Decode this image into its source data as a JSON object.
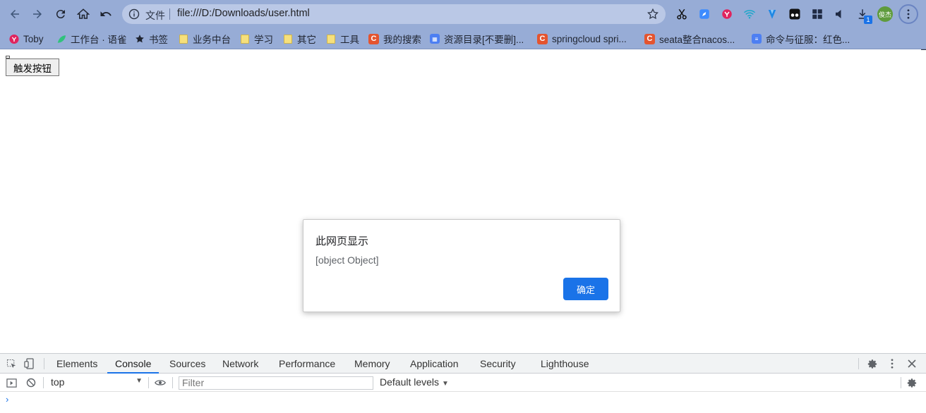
{
  "browser": {
    "url_scheme": "文件",
    "url": "file:///D:/Downloads/user.html",
    "profile_name": "俊杰",
    "download_badge": "1",
    "bookmarks": [
      {
        "label": "Toby",
        "icon": "red-circle-icon"
      },
      {
        "label": "工作台 · 语雀",
        "icon": "green-leaf-icon"
      },
      {
        "label": "书签",
        "icon": "star-icon"
      },
      {
        "label": "业务中台",
        "icon": "folder-icon"
      },
      {
        "label": "学习",
        "icon": "folder-icon"
      },
      {
        "label": "其它",
        "icon": "folder-icon"
      },
      {
        "label": "工具",
        "icon": "folder-icon"
      },
      {
        "label": "我的搜索",
        "icon": "c-icon"
      },
      {
        "label": "资源目录[不要删]...",
        "icon": "grid-icon"
      },
      {
        "label": "springcloud spri...",
        "icon": "c-icon"
      },
      {
        "label": "seata整合nacos...",
        "icon": "c-icon"
      },
      {
        "label": "命令与征服：红色...",
        "icon": "doc-icon"
      }
    ]
  },
  "page": {
    "trigger_button_label": "触发按钮"
  },
  "alert": {
    "title": "此网页显示",
    "message": "[object Object]",
    "ok_label": "确定"
  },
  "devtools": {
    "tabs": [
      "Elements",
      "Console",
      "Sources",
      "Network",
      "Performance",
      "Memory",
      "Application",
      "Security",
      "Lighthouse"
    ],
    "active_tab": "Console",
    "context": "top",
    "filter_placeholder": "Filter",
    "levels": "Default levels"
  },
  "colors": {
    "toolbar": "#97acd6",
    "accent": "#1a73e8"
  }
}
